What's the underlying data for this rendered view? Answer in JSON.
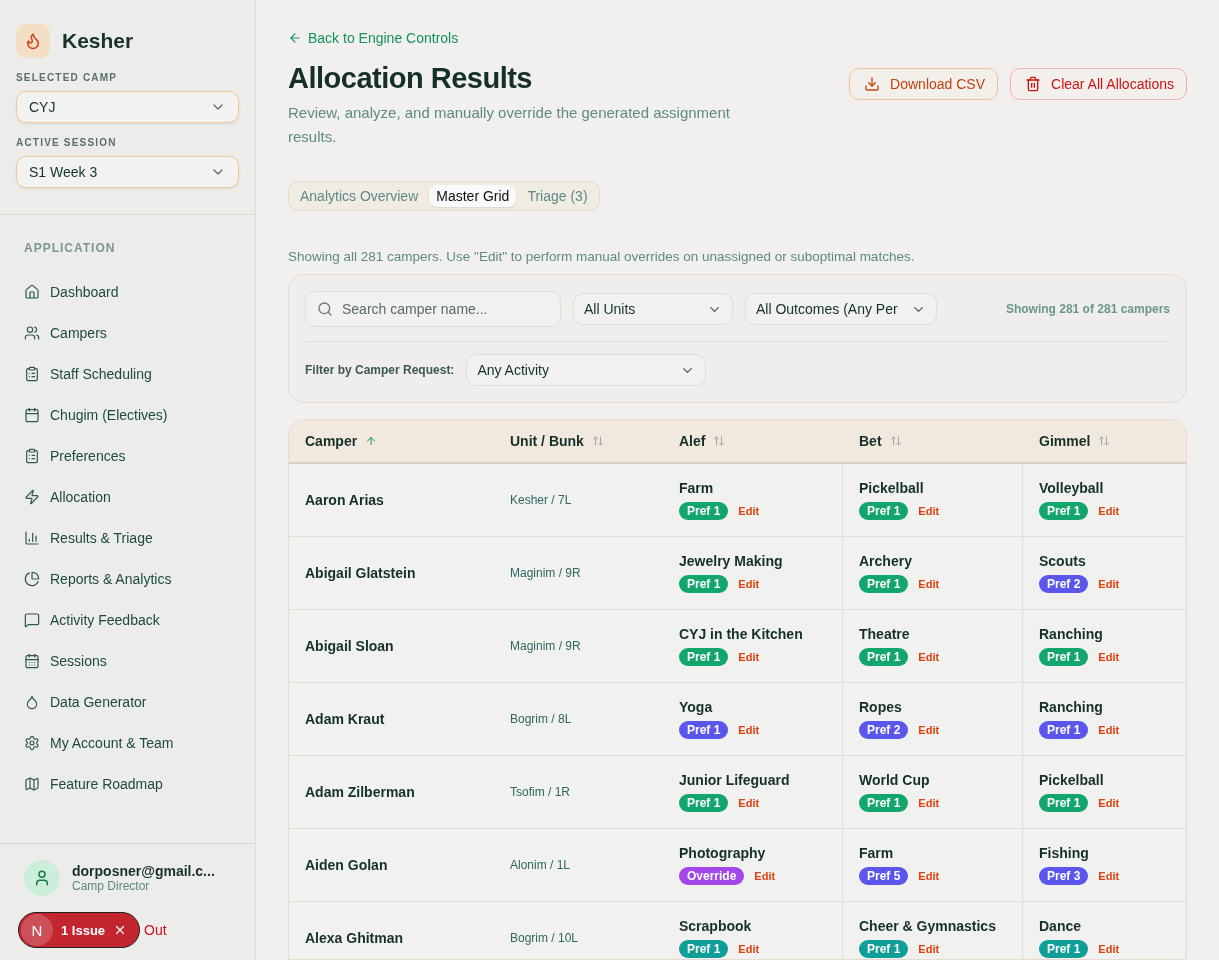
{
  "brand": {
    "name": "Kesher"
  },
  "selectors": [
    {
      "label": "SELECTED CAMP",
      "value": "CYJ"
    },
    {
      "label": "ACTIVE SESSION",
      "value": "S1 Week 3"
    }
  ],
  "nav": {
    "heading": "APPLICATION",
    "items": [
      {
        "label": "Dashboard"
      },
      {
        "label": "Campers"
      },
      {
        "label": "Staff Scheduling"
      },
      {
        "label": "Chugim (Electives)"
      },
      {
        "label": "Preferences"
      },
      {
        "label": "Allocation"
      },
      {
        "label": "Results & Triage"
      },
      {
        "label": "Reports & Analytics"
      },
      {
        "label": "Activity Feedback"
      },
      {
        "label": "Sessions"
      },
      {
        "label": "Data Generator"
      },
      {
        "label": "My Account & Team"
      },
      {
        "label": "Feature Roadmap"
      }
    ]
  },
  "user": {
    "email": "dorposner@gmail.c...",
    "role": "Camp Director"
  },
  "issue_badge": {
    "letter": "N",
    "label": "1 Issue"
  },
  "sign_out": "Out",
  "back_link": "Back to Engine Controls",
  "title": "Allocation Results",
  "subtitle": "Review, analyze, and manually override the generated assignment results.",
  "actions": [
    {
      "label": "Download CSV",
      "kind": "download"
    },
    {
      "label": "Clear All Allocations",
      "kind": "danger"
    }
  ],
  "tabs": [
    {
      "label": "Analytics Overview",
      "selected": false
    },
    {
      "label": "Master Grid",
      "selected": true
    },
    {
      "label": "Triage (3)",
      "selected": false
    }
  ],
  "info": "Showing all 281 campers. Use \"Edit\" to perform manual overrides on unassigned or suboptimal matches.",
  "filters": {
    "search": {
      "placeholder": "Search camper name..."
    },
    "selects": [
      "All Units",
      "All Outcomes (Any Per"
    ],
    "count": "Showing 281 of 281 campers",
    "request_label": "Filter by Camper Request:",
    "request_value": "Any Activity"
  },
  "columns": [
    {
      "label": "Camper",
      "sorted": true
    },
    {
      "label": "Unit / Bunk",
      "sorted": false
    },
    {
      "label": "Alef",
      "sorted": false
    },
    {
      "label": "Bet",
      "sorted": false
    },
    {
      "label": "Gimmel",
      "sorted": false
    }
  ],
  "rows": [
    {
      "name": "Aaron Arias",
      "unit": "Kesher / 7L",
      "slots": [
        {
          "activity": "Farm",
          "badge": "Pref 1",
          "color": "#12a66e",
          "edit": "Edit"
        },
        {
          "activity": "Pickelball",
          "badge": "Pref 1",
          "color": "#12a66e",
          "edit": "Edit"
        },
        {
          "activity": "Volleyball",
          "badge": "Pref 1",
          "color": "#12a66e",
          "edit": "Edit"
        }
      ]
    },
    {
      "name": "Abigail Glatstein",
      "unit": "Maginim / 9R",
      "slots": [
        {
          "activity": "Jewelry Making",
          "badge": "Pref 1",
          "color": "#12a66e",
          "edit": "Edit"
        },
        {
          "activity": "Archery",
          "badge": "Pref 1",
          "color": "#12a66e",
          "edit": "Edit"
        },
        {
          "activity": "Scouts",
          "badge": "Pref 2",
          "color": "#5b57ec",
          "edit": "Edit"
        }
      ]
    },
    {
      "name": "Abigail Sloan",
      "unit": "Maginim / 9R",
      "slots": [
        {
          "activity": "CYJ in the Kitchen",
          "badge": "Pref 1",
          "color": "#12a66e",
          "edit": "Edit"
        },
        {
          "activity": "Theatre",
          "badge": "Pref 1",
          "color": "#12a66e",
          "edit": "Edit"
        },
        {
          "activity": "Ranching",
          "badge": "Pref 1",
          "color": "#12a66e",
          "edit": "Edit"
        }
      ]
    },
    {
      "name": "Adam Kraut",
      "unit": "Bogrim / 8L",
      "slots": [
        {
          "activity": "Yoga",
          "badge": "Pref 1",
          "color": "#5b57ec",
          "edit": "Edit"
        },
        {
          "activity": "Ropes",
          "badge": "Pref 2",
          "color": "#5b57ec",
          "edit": "Edit"
        },
        {
          "activity": "Ranching",
          "badge": "Pref 1",
          "color": "#5b57ec",
          "edit": "Edit"
        }
      ]
    },
    {
      "name": "Adam Zilberman",
      "unit": "Tsofim / 1R",
      "slots": [
        {
          "activity": "Junior Lifeguard",
          "badge": "Pref 1",
          "color": "#12a66e",
          "edit": "Edit"
        },
        {
          "activity": "World Cup",
          "badge": "Pref 1",
          "color": "#12a66e",
          "edit": "Edit"
        },
        {
          "activity": "Pickelball",
          "badge": "Pref 1",
          "color": "#12a66e",
          "edit": "Edit"
        }
      ]
    },
    {
      "name": "Aiden Golan",
      "unit": "Alonim / 1L",
      "slots": [
        {
          "activity": "Photography",
          "badge": "Override",
          "color": "#a346ea",
          "edit": "Edit"
        },
        {
          "activity": "Farm",
          "badge": "Pref 5",
          "color": "#5b57ec",
          "edit": "Edit"
        },
        {
          "activity": "Fishing",
          "badge": "Pref 3",
          "color": "#5b57ec",
          "edit": "Edit"
        }
      ]
    },
    {
      "name": "Alexa Ghitman",
      "unit": "Bogrim / 10L",
      "slots": [
        {
          "activity": "Scrapbook",
          "badge": "Pref 1",
          "color": "#0f9f98",
          "edit": "Edit"
        },
        {
          "activity": "Cheer & Gymnastics",
          "badge": "Pref 1",
          "color": "#0f9f98",
          "edit": "Edit"
        },
        {
          "activity": "Dance",
          "badge": "Pref 1",
          "color": "#0f9f98",
          "edit": "Edit"
        }
      ]
    }
  ]
}
